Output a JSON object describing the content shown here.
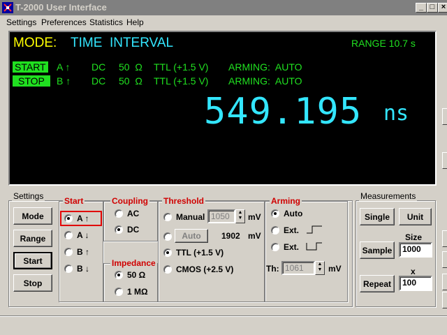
{
  "window": {
    "title": "T-2000 User Interface",
    "minimize": "_",
    "maximize": "□",
    "close": "×"
  },
  "menu": [
    "Settings",
    "Preferences",
    "Statistics",
    "Help"
  ],
  "display": {
    "mode_label": "MODE:",
    "mode_value": "TIME  INTERVAL",
    "range": "RANGE 10.7 s",
    "start_row": {
      "tag": "START",
      "channel": "A ↑",
      "coupling": "DC",
      "impedance": "50  Ω",
      "threshold": "TTL (+1.5 V)",
      "arming": "ARMING:  AUTO"
    },
    "stop_row": {
      "tag": "STOP",
      "channel": "B ↑",
      "coupling": "DC",
      "impedance": "50  Ω",
      "threshold": "TTL (+1.5 V)",
      "arming": "ARMING:  AUTO"
    },
    "measurement": "549.195",
    "unit": "ns",
    "colors": {
      "yellow": "#ffff00",
      "cyan": "#33e6ff",
      "green": "#20e020",
      "background": "#000000"
    }
  },
  "settings": {
    "title": "Settings",
    "buttons": [
      "Mode",
      "Range",
      "Start",
      "Stop"
    ],
    "start": {
      "title": "Start",
      "options": [
        "A ↑",
        "A ↓",
        "B ↑",
        "B ↓"
      ],
      "selected": 0
    },
    "coupling": {
      "title": "Coupling",
      "options": [
        "AC",
        "DC"
      ],
      "selected": 1
    },
    "impedance": {
      "title": "Impedance",
      "options": [
        "50 Ω",
        "1 MΩ"
      ],
      "selected": 0
    },
    "threshold": {
      "title": "Threshold",
      "manual_label": "Manual",
      "manual_value": "1050",
      "mv": "mV",
      "auto_button": "Auto",
      "auto_value": "1902",
      "ttl": "TTL (+1.5 V)",
      "cmos": "CMOS (+2.5 V)",
      "selected": "ttl"
    },
    "arming": {
      "title": "Arming",
      "auto": "Auto",
      "ext1": "Ext.",
      "ext2": "Ext.",
      "th_label": "Th:",
      "th_value": "1061",
      "mv": "mV",
      "selected": "auto"
    }
  },
  "measurements": {
    "title": "Measurements",
    "single": "Single",
    "unit": "Unit",
    "sample": "Sample",
    "size_label": "Size",
    "size_value": "1000",
    "repeat": "Repeat",
    "x_label": "x",
    "x_value": "100"
  }
}
